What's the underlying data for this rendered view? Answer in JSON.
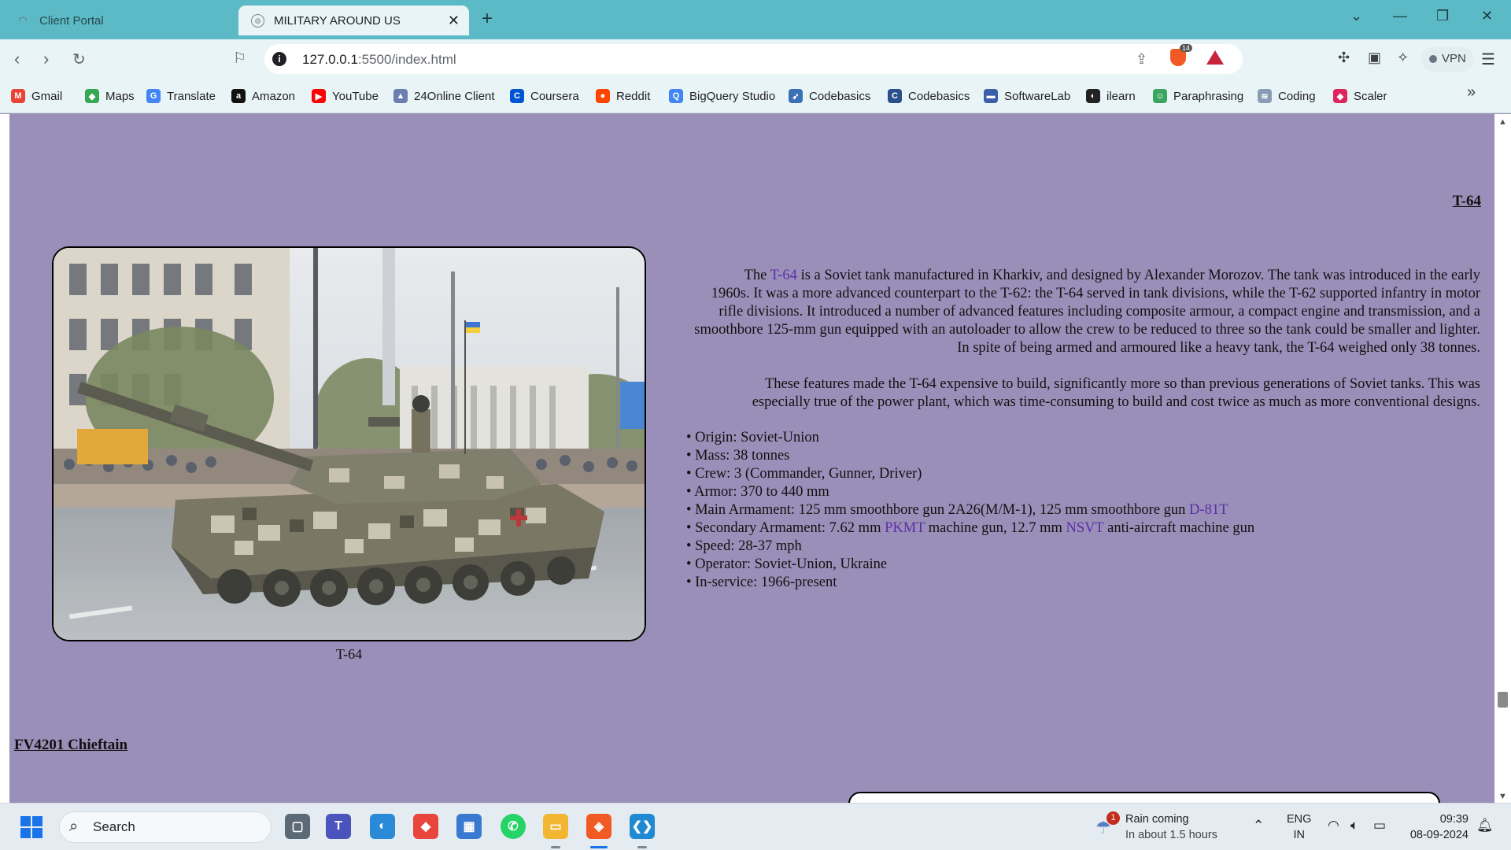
{
  "browser": {
    "tabs": [
      {
        "title": "Client Portal",
        "active": false
      },
      {
        "title": "MILITARY AROUND US",
        "active": true
      }
    ],
    "url_host": "127.0.0.1",
    "url_path": ":5500/index.html",
    "shield_count": "14",
    "vpn_label": "VPN",
    "bookmarks": [
      {
        "label": "Gmail",
        "icon": "gmail-icon",
        "color": "#ea4335",
        "glyph": "M"
      },
      {
        "label": "Maps",
        "icon": "maps-icon",
        "color": "#34a853",
        "glyph": "◆"
      },
      {
        "label": "Translate",
        "icon": "translate-icon",
        "color": "#4285f4",
        "glyph": "G"
      },
      {
        "label": "Amazon",
        "icon": "amazon-icon",
        "color": "#111111",
        "glyph": "a"
      },
      {
        "label": "YouTube",
        "icon": "youtube-icon",
        "color": "#ff0000",
        "glyph": "▶"
      },
      {
        "label": "24Online Client",
        "icon": "online-client-icon",
        "color": "#6a7fb0",
        "glyph": "▲"
      },
      {
        "label": "Coursera",
        "icon": "coursera-icon",
        "color": "#0056d2",
        "glyph": "C"
      },
      {
        "label": "Reddit",
        "icon": "reddit-icon",
        "color": "#ff4500",
        "glyph": "●"
      },
      {
        "label": "BigQuery Studio",
        "icon": "bigquery-icon",
        "color": "#4285f4",
        "glyph": "Q"
      },
      {
        "label": "Codebasics",
        "icon": "rocket-icon",
        "color": "#3b6fb6",
        "glyph": "➶"
      },
      {
        "label": "Codebasics",
        "icon": "codebasics-icon",
        "color": "#2b4f8a",
        "glyph": "C"
      },
      {
        "label": "SoftwareLab",
        "icon": "softwarelab-icon",
        "color": "#3a5fa8",
        "glyph": "▬"
      },
      {
        "label": "ilearn",
        "icon": "ilearn-icon",
        "color": "#222222",
        "glyph": "◐"
      },
      {
        "label": "Paraphrasing",
        "icon": "paraphrasing-icon",
        "color": "#3aa55d",
        "glyph": "☺"
      },
      {
        "label": "Coding",
        "icon": "coding-icon",
        "color": "#8a9bb5",
        "glyph": "≋"
      },
      {
        "label": "Scaler",
        "icon": "scaler-icon",
        "color": "#e0245e",
        "glyph": "◆"
      }
    ]
  },
  "page": {
    "heading": "T-64",
    "caption": "T-64",
    "description": {
      "p1_before_link": "The ",
      "p1_link": "T-64",
      "p1_after_link": " is a Soviet tank manufactured in Kharkiv, and designed by Alexander Morozov. The tank was introduced in the early 1960s. It was a more advanced counterpart to the T-62: the T-64 served in tank divisions, while the T-62 supported infantry in motor rifle divisions. It introduced a number of advanced features including composite armour, a compact engine and transmission, and a smoothbore 125-mm gun equipped with an autoloader to allow the crew to be reduced to three so the tank could be smaller and lighter. In spite of being armed and armoured like a heavy tank, the T-64 weighed only 38 tonnes.",
      "p2": "These features made the T-64 expensive to build, significantly more so than previous generations of Soviet tanks. This was especially true of the power plant, which was time-consuming to build and cost twice as much as more conventional designs."
    },
    "specs": {
      "origin": "Origin: Soviet-Union",
      "mass": "Mass: 38 tonnes",
      "crew": "Crew: 3 (Commander, Gunner, Driver)",
      "armor": "Armor: 370 to 440 mm",
      "main_armament_text": "Main Armament: 125 mm smoothbore gun 2A26(M/M-1), 125 mm smoothbore gun ",
      "main_armament_link": "D-81T",
      "secondary_text_1": "Secondary Armament: 7.62 mm ",
      "secondary_link_1": "PKMT",
      "secondary_text_2": " machine gun, 12.7 mm ",
      "secondary_link_2": "NSVT",
      "secondary_text_3": " anti-aircraft machine gun",
      "speed": "Speed: 28-37 mph",
      "operator": "Operator: Soviet-Union, Ukraine",
      "in_service": "In-service: 1966-present"
    },
    "next_heading": "FV4201 Chieftain"
  },
  "taskbar": {
    "search_label": "Search",
    "weather_badge": "1",
    "weather_line1": "Rain coming",
    "weather_line2": "In about 1.5 hours",
    "lang_line1": "ENG",
    "lang_line2": "IN",
    "time": "09:39",
    "date": "08-09-2024"
  },
  "colors": {
    "page_background": "#9a8fb8",
    "link": "#5b2ea6",
    "tab_strip": "#5bbac5"
  }
}
